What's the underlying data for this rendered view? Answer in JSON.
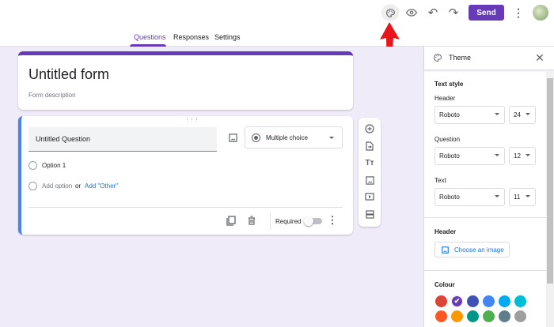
{
  "topbar": {
    "send_label": "Send",
    "icons": [
      "palette-icon",
      "eye-icon",
      "undo-icon",
      "redo-icon",
      "more-vert-icon"
    ]
  },
  "tabs": [
    {
      "label": "Questions",
      "active": true
    },
    {
      "label": "Responses"
    },
    {
      "label": "Settings"
    }
  ],
  "form": {
    "title": "Untitled form",
    "description": "Form description"
  },
  "question": {
    "title": "Untitled Question",
    "type": "Multiple choice",
    "option1": "Option 1",
    "add_option": "Add option",
    "or": "or",
    "add_other": "Add \"Other\"",
    "required_label": "Required",
    "required": false
  },
  "theme": {
    "title": "Theme",
    "text_style": "Text style",
    "header_label": "Header",
    "header_font": "Roboto",
    "header_size": "24",
    "question_label": "Question",
    "question_font": "Roboto",
    "question_size": "12",
    "text_label": "Text",
    "text_font": "Roboto",
    "text_size": "11",
    "header_section": "Header",
    "choose_image": "Choose an image",
    "colour_label": "Colour",
    "colours": [
      "#db4437",
      "#673ab7",
      "#3f51b5",
      "#4285f4",
      "#03a9f4",
      "#00bcd4",
      "#ff5722",
      "#ff9800",
      "#009688",
      "#4caf50",
      "#607d8b",
      "#9e9e9e"
    ],
    "selected_colour": "#673ab7"
  },
  "colors": {
    "accent": "#673ab7",
    "link": "#1a73e8",
    "background": "#f0ebf8",
    "annotation_arrow": "#e8161b"
  }
}
